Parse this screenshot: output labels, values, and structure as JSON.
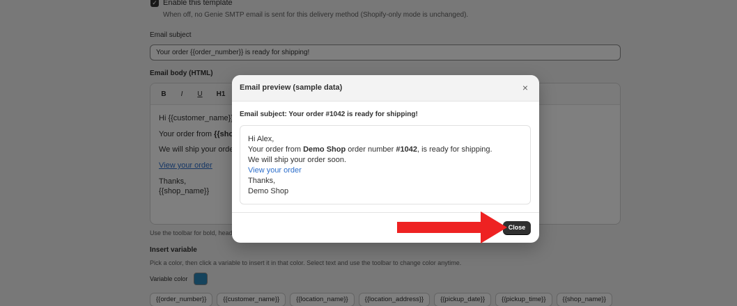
{
  "background": {
    "enable_label": "Enable this template",
    "enable_help": "When off, no Genie SMTP email is sent for this delivery method (Shopify-only mode is unchanged).",
    "subject_label": "Email subject",
    "subject_value": "Your order {{order_number}} is ready for shipping!",
    "body_label": "Email body (HTML)",
    "toolbar": {
      "bold": "B",
      "italic": "I",
      "underline": "U",
      "h1": "H1"
    },
    "editor_lines": {
      "greeting": "Hi {{customer_name}}",
      "order_from": "Your order from ",
      "order_from_bold": "{{sho",
      "ship": "We will ship your orde",
      "link": "View your order",
      "thanks": "Thanks,",
      "shop": "{{shop_name}}"
    },
    "toolbar_help": "Use the toolbar for bold, head",
    "insert_variable_label": "Insert variable",
    "pick_help": "Pick a color, then click a variable to insert it in that color. Select text and use the toolbar to change color anytime.",
    "variable_color_label": "Variable color",
    "variable_color": "#2b86b8",
    "variables": [
      "{{order_number}}",
      "{{customer_name}}",
      "{{location_name}}",
      "{{location_address}}",
      "{{pickup_date}}",
      "{{pickup_time}}",
      "{{shop_name}}"
    ]
  },
  "modal": {
    "title": "Email preview (sample data)",
    "close_glyph": "×",
    "subject_line": "Email subject: Your order #1042 is ready for shipping!",
    "body": {
      "greeting": "Hi Alex,",
      "order_prefix": "Your order from ",
      "shop_bold": "Demo Shop",
      "order_mid": " order number ",
      "order_number_bold": "#1042",
      "order_suffix": ", is ready for shipping.",
      "ship": "We will ship your order soon.",
      "link": "View your order",
      "thanks": "Thanks,",
      "shop": "Demo Shop"
    },
    "close_button": "Close"
  },
  "annotation": {
    "arrow_color": "#ee2222"
  }
}
